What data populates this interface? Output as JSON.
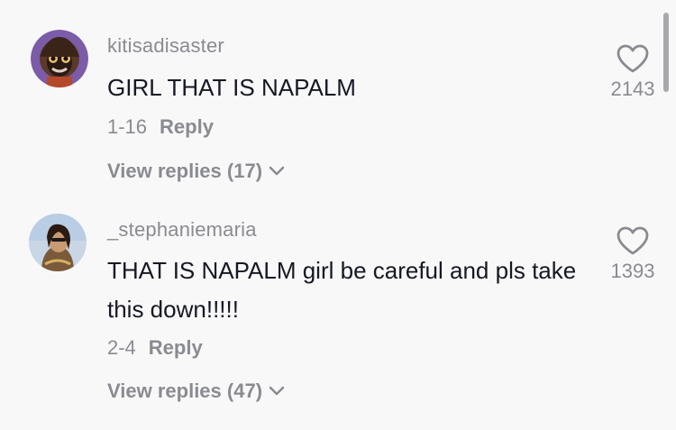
{
  "comments": [
    {
      "username": "kitisadisaster",
      "text": "GIRL THAT IS NAPALM",
      "date": "1-16",
      "reply_label": "Reply",
      "view_replies": "View replies (17)",
      "likes": "2143",
      "avatar_icon": "avatar-image"
    },
    {
      "username": "_stephaniemaria",
      "text": "THAT IS NAPALM girl be careful and pls take this down!!!!!",
      "date": "2-4",
      "reply_label": "Reply",
      "view_replies": "View replies (47)",
      "likes": "1393",
      "avatar_icon": "avatar-image"
    }
  ],
  "colors": {
    "background": "#f8f8f8",
    "text_primary": "#161823",
    "text_secondary": "#8a8b91"
  }
}
